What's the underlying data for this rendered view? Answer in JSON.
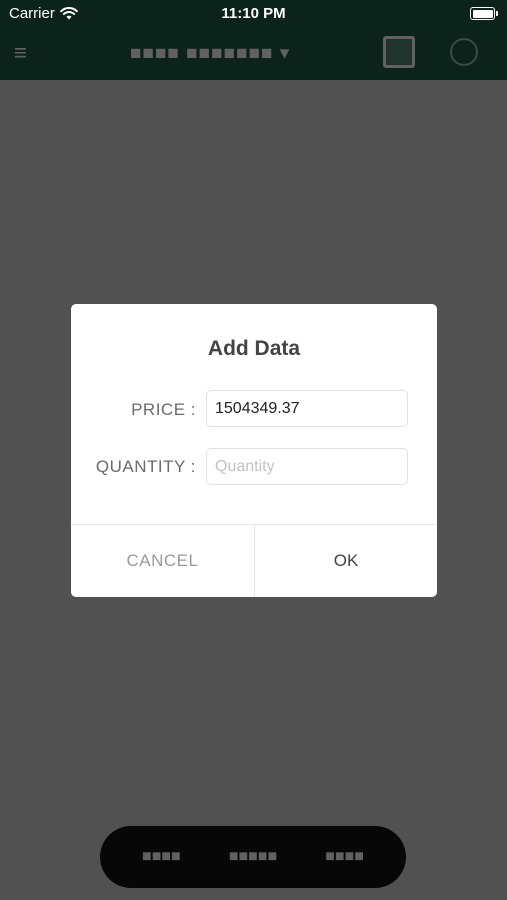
{
  "status_bar": {
    "carrier": "Carrier",
    "time": "11:10 PM"
  },
  "app_header": {
    "icons": [
      "menu-icon",
      "calendar-icon",
      "more-icon"
    ]
  },
  "dialog": {
    "title": "Add Data",
    "price_label": "PRICE :",
    "price_value": "1504349.37",
    "quantity_label": "QUANTITY :",
    "quantity_value": "",
    "quantity_placeholder": "Quantity",
    "cancel_label": "CANCEL",
    "ok_label": "OK"
  },
  "colors": {
    "header": "#1f5e49",
    "overlay": "rgba(0,0,0,0.62)",
    "dialog_bg": "#ffffff"
  }
}
